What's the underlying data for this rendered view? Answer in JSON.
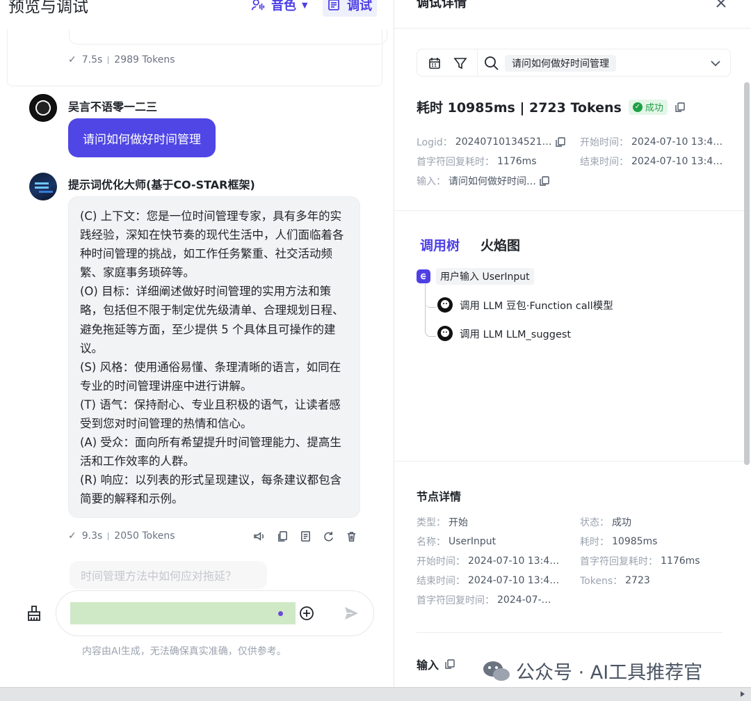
{
  "left": {
    "title": "预览与调试",
    "voice_label": "音色",
    "debug_label": "调试",
    "prev_meta": {
      "time": "7.5s",
      "tokens": "2989 Tokens"
    },
    "user": {
      "name": "吴言不语零一二三",
      "message": "请问如何做好时间管理"
    },
    "bot": {
      "name": "提示词优化大师(基于CO-STAR框架)",
      "paragraphs": [
        "(C) 上下文：您是一位时间管理专家，具有多年的实践经验，深知在快节奏的现代生活中，人们面临着各种时间管理的挑战，如工作任务繁重、社交活动频繁、家庭事务琐碎等。",
        "(O) 目标：详细阐述做好时间管理的实用方法和策略，包括但不限于制定优先级清单、合理规划日程、避免拖延等方面，至少提供 5 个具体且可操作的建议。",
        "(S) 风格：使用通俗易懂、条理清晰的语言，如同在专业的时间管理讲座中进行讲解。",
        "(T) 语气：保持耐心、专业且积极的语气，让读者感受到您对时间管理的热情和信心。",
        "(A) 受众：面向所有希望提升时间管理能力、提高生活和工作效率的人群。",
        "(R) 响应：以列表的形式呈现建议，每条建议都包含简要的解释和示例。"
      ],
      "time": "9.3s",
      "tokens": "2050 Tokens"
    },
    "suggestion": "时间管理方法中如何应对拖延？",
    "input_value": "",
    "disclaimer": "内容由AI生成，无法确保真实准确，仅供参考。"
  },
  "right": {
    "title": "调试详情",
    "search_tag": "请问如何做好时间管理",
    "summary": "耗时 10985ms | 2723 Tokens",
    "status": "成功",
    "meta": {
      "logid_label": "Logid：",
      "logid": "20240710134521…",
      "start_label": "开始时间：",
      "start": "2024-07-10 13:4…",
      "first_label": "首字符回复耗时：",
      "first": "1176ms",
      "end_label": "结束时间：",
      "end": "2024-07-10 13:4…",
      "input_label": "输入：",
      "input": "请问如何做好时间…"
    },
    "tabs": [
      "调用树",
      "火焰图"
    ],
    "tree": {
      "root": "用户输入 UserInput",
      "children": [
        "调用 LLM 豆包·Function call模型",
        "调用 LLM LLM_suggest"
      ]
    },
    "node_title": "节点详情",
    "node": {
      "type_label": "类型：",
      "type": "开始",
      "state_label": "状态：",
      "state": "成功",
      "name_label": "名称：",
      "name": "UserInput",
      "cost_label": "耗时：",
      "cost": "10985ms",
      "start_label": "开始时间：",
      "start": "2024-07-10 13:4…",
      "first_label": "首字符回复耗时：",
      "first": "1176ms",
      "end_label": "结束时间：",
      "end": "2024-07-10 13:4…",
      "tokens_label": "Tokens：",
      "tokens": "2723",
      "firsttime_label": "首字符回复时间：",
      "firsttime": "2024-07-…"
    },
    "input_section": "输入"
  },
  "watermark": "公众号 · AI工具推荐官",
  "colors": {
    "accent": "#4e40e5",
    "success": "#1fa045",
    "input_highlight": "#cfe9c6"
  }
}
